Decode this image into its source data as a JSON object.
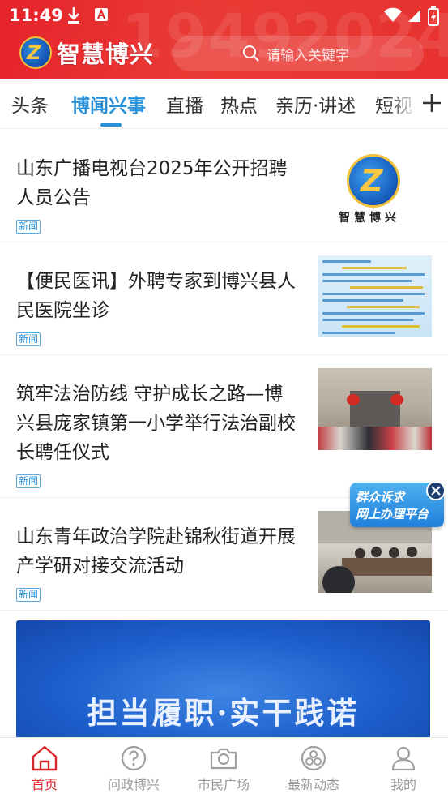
{
  "status_bar": {
    "time": "11:49",
    "download_icon": "download-icon",
    "app_icon": "a-box-icon",
    "wifi_icon": "wifi-icon",
    "signal_icon": "signal-icon",
    "battery_icon": "battery-charging-icon"
  },
  "header": {
    "app_name": "智慧博兴",
    "search_placeholder": "请输入关键字",
    "accent_color": "#e5232a"
  },
  "tabs": {
    "items": [
      {
        "label": "头条",
        "active": false
      },
      {
        "label": "博闻兴事",
        "active": true
      },
      {
        "label": "直播",
        "active": false
      },
      {
        "label": "热点",
        "active": false
      },
      {
        "label": "亲历·讲述",
        "active": false
      },
      {
        "label": "短视",
        "active": false
      }
    ],
    "active_color": "#2a91d8",
    "add_icon": "plus-icon"
  },
  "news": [
    {
      "title": "山东广播电视台2025年公开招聘人员公告",
      "tag": "新闻",
      "thumb_caption": "智慧博兴"
    },
    {
      "title": "【便民医讯】外聘专家到博兴县人民医院坐诊",
      "tag": "新闻"
    },
    {
      "title": "筑牢法治防线  守护成长之路—博兴县庞家镇第一小学举行法治副校长聘任仪式",
      "tag": "新闻"
    },
    {
      "title": "山东青年政治学院赴锦秋街道开展产学研对接交流活动",
      "tag": "新闻"
    }
  ],
  "banner": {
    "text": "担当履职·实干践诺"
  },
  "floating_badge": {
    "line1": "群众诉求",
    "line2": "网上办理平台"
  },
  "bottom_nav": [
    {
      "label": "首页",
      "icon": "home-icon",
      "active": true
    },
    {
      "label": "问政博兴",
      "icon": "question-icon",
      "active": false
    },
    {
      "label": "市民广场",
      "icon": "camera-icon",
      "active": false
    },
    {
      "label": "最新动态",
      "icon": "activity-icon",
      "active": false
    },
    {
      "label": "我的",
      "icon": "user-icon",
      "active": false
    }
  ]
}
